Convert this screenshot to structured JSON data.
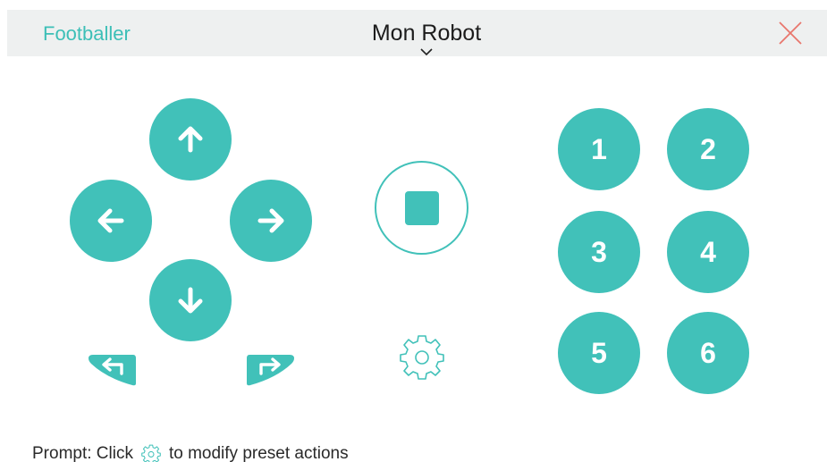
{
  "header": {
    "mode_label": "Footballer",
    "robot_name": "Mon Robot",
    "close_icon": "close-x-icon"
  },
  "controls": {
    "up_icon": "arrow-up-icon",
    "left_icon": "arrow-left-icon",
    "right_icon": "arrow-right-icon",
    "down_icon": "arrow-down-icon",
    "turn_left_icon": "turn-left-icon",
    "turn_right_icon": "turn-right-icon",
    "stop_icon": "stop-icon",
    "settings_icon": "gear-icon"
  },
  "presets": [
    "1",
    "2",
    "3",
    "4",
    "5",
    "6"
  ],
  "prompt": {
    "prefix": "Prompt: Click",
    "suffix": "to modify preset actions"
  },
  "colors": {
    "accent": "#41c1b9",
    "close": "#e8766c",
    "topbar": "#eef0f0"
  }
}
